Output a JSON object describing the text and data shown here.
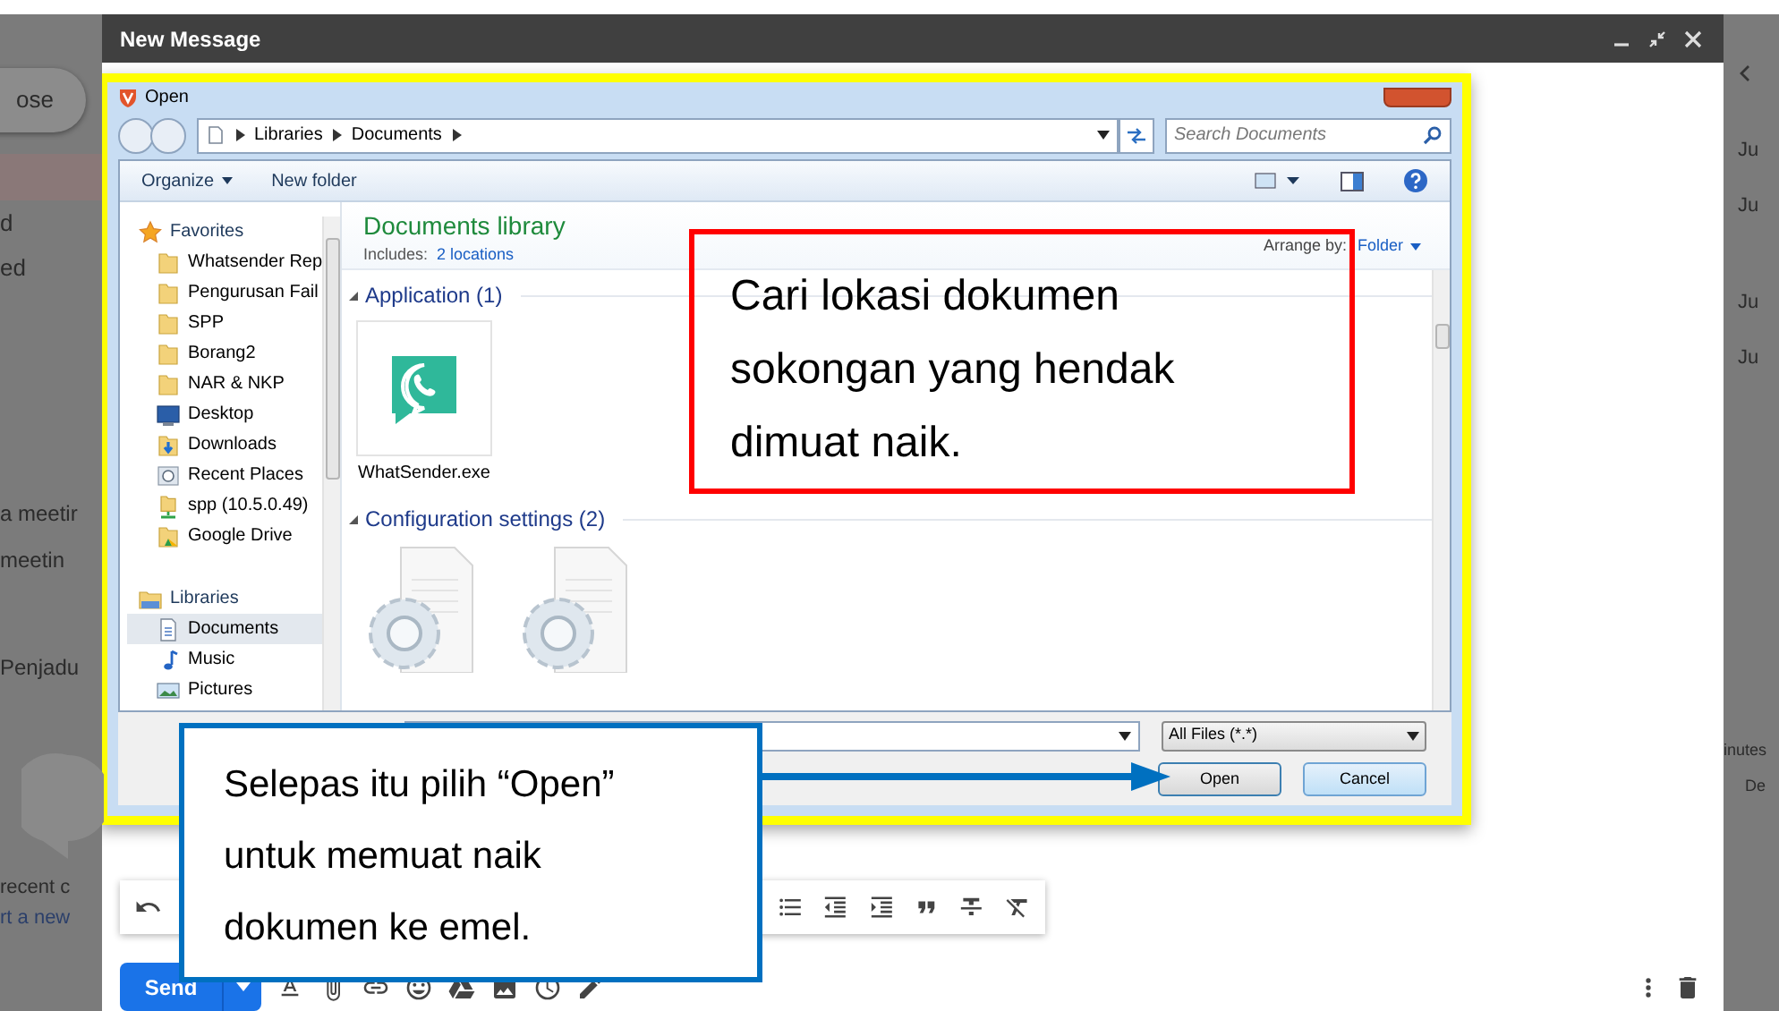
{
  "gmail_background": {
    "compose_button": "ose",
    "nav_items": [
      "d",
      "ed"
    ],
    "meet_items": [
      "a meetir",
      "meetin"
    ],
    "calendar_label": "Penjadu",
    "chat_hint": "recent c",
    "chat_link": "rt a new",
    "right_dates": [
      "Ju",
      "Ju",
      "Ju",
      "Ju"
    ],
    "right_footer": [
      "inutes",
      "De"
    ]
  },
  "compose": {
    "title": "New Message",
    "send_label": "Send"
  },
  "open_dialog": {
    "title": "Open",
    "breadcrumb": [
      "Libraries",
      "Documents"
    ],
    "search_placeholder": "Search Documents",
    "organize": "Organize",
    "new_folder": "New folder",
    "sidebar": [
      {
        "label": "Favorites",
        "kind": "star",
        "children": [
          {
            "label": "Whatsender Rep",
            "kind": "folder",
            "selected": false
          },
          {
            "label": "Pengurusan Fail",
            "kind": "folder",
            "selected": false
          },
          {
            "label": "SPP",
            "kind": "folder",
            "selected": false
          },
          {
            "label": "Borang2",
            "kind": "folder",
            "selected": false
          },
          {
            "label": "NAR & NKP",
            "kind": "folder",
            "selected": false
          },
          {
            "label": "Desktop",
            "kind": "desktop",
            "selected": false
          },
          {
            "label": "Downloads",
            "kind": "downloads",
            "selected": false
          },
          {
            "label": "Recent Places",
            "kind": "recent",
            "selected": false
          },
          {
            "label": "spp (10.5.0.49)",
            "kind": "network",
            "selected": false
          },
          {
            "label": "Google Drive",
            "kind": "drive",
            "selected": false
          }
        ]
      },
      {
        "label": "Libraries",
        "kind": "library",
        "children": [
          {
            "label": "Documents",
            "kind": "document",
            "selected": true
          },
          {
            "label": "Music",
            "kind": "music",
            "selected": false
          },
          {
            "label": "Pictures",
            "kind": "pictures",
            "selected": false
          }
        ]
      }
    ],
    "library_title": "Documents library",
    "includes_label": "Includes:",
    "includes_link": "2 locations",
    "arrange_label": "Arrange by:",
    "arrange_value": "Folder",
    "groups": [
      {
        "title": "Application (1)",
        "items": [
          {
            "label": "WhatSender.exe",
            "kind": "app"
          }
        ]
      },
      {
        "title": "Configuration settings (2)",
        "items": [
          {
            "kind": "config"
          },
          {
            "kind": "config"
          }
        ]
      }
    ],
    "file_type": "All Files (*.*)",
    "buttons": [
      "Open",
      "Cancel"
    ]
  },
  "callouts": [
    {
      "text": "Cari lokasi dokumen\nsokongan yang hendak\ndimuat naik.",
      "color": "#ff0000"
    },
    {
      "text": "Selepas itu pilih “Open”\nuntuk memuat naik\ndokumen ke emel.",
      "color": "#0070c0"
    }
  ]
}
